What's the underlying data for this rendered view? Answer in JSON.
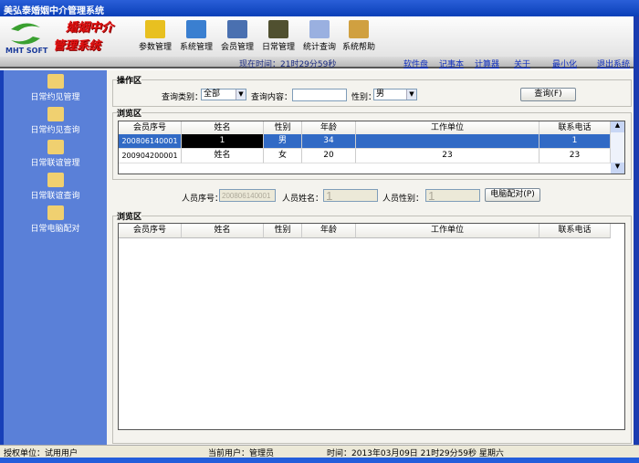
{
  "window": {
    "title": "美弘泰婚姻中介管理系统"
  },
  "brand": {
    "logo_text": "MHT SOFT",
    "slogan1": "婚姻中介",
    "slogan2": "管理系统"
  },
  "toolbar": [
    {
      "label": "参数管理",
      "icon": "warning-gear-icon",
      "color": "#e8c020"
    },
    {
      "label": "系统管理",
      "icon": "cabinet-icon",
      "color": "#3a7fd0"
    },
    {
      "label": "会员管理",
      "icon": "computer-icon",
      "color": "#4a70b0"
    },
    {
      "label": "日常管理",
      "icon": "notepad-icon",
      "color": "#505030"
    },
    {
      "label": "统计查询",
      "icon": "calculator-icon",
      "color": "#9ab0e0"
    },
    {
      "label": "系统帮助",
      "icon": "home-icon",
      "color": "#d0a040"
    }
  ],
  "timebar": {
    "now": "现在时间：21时29分59秒",
    "links": [
      "软件盘",
      "记事本",
      "计算器",
      "关于",
      "最小化",
      "退出系统"
    ]
  },
  "sidebar": [
    {
      "label": "日常约见管理",
      "icon": "clipboard-icon"
    },
    {
      "label": "日常约见查询",
      "icon": "document-search-icon"
    },
    {
      "label": "日常联谊管理",
      "icon": "group-icon"
    },
    {
      "label": "日常联谊查询",
      "icon": "file-info-icon"
    },
    {
      "label": "日常电脑配对",
      "icon": "folder-icon"
    }
  ],
  "ops": {
    "legend": "操作区",
    "type_label": "查询类别：",
    "type_value": "全部",
    "content_label": "查询内容：",
    "content_value": "",
    "gender_label": "性别：",
    "gender_value": "男",
    "query_button": "查询(F)"
  },
  "browse1": {
    "legend": "浏览区",
    "columns": [
      "会员序号",
      "姓名",
      "性别",
      "年龄",
      "工作单位",
      "联系电话"
    ],
    "rows": [
      [
        "200806140001",
        "1",
        "男",
        "34",
        "",
        "1"
      ],
      [
        "200904200001",
        "姓名",
        "女",
        "20",
        "23",
        "23"
      ]
    ]
  },
  "pair": {
    "id_label": "人员序号：",
    "id_value": "200806140001",
    "name_label": "人员姓名：",
    "name_value": "1",
    "gender_label": "人员性别：",
    "gender_value": "1",
    "button": "电脑配对(P)"
  },
  "browse2": {
    "legend": "浏览区",
    "columns": [
      "会员序号",
      "姓名",
      "性别",
      "年龄",
      "工作单位",
      "联系电话"
    ]
  },
  "status": {
    "unit": "授权单位：试用用户",
    "user": "当前用户：管理员",
    "time": "时间：2013年03月09日 21时29分59秒 星期六"
  }
}
